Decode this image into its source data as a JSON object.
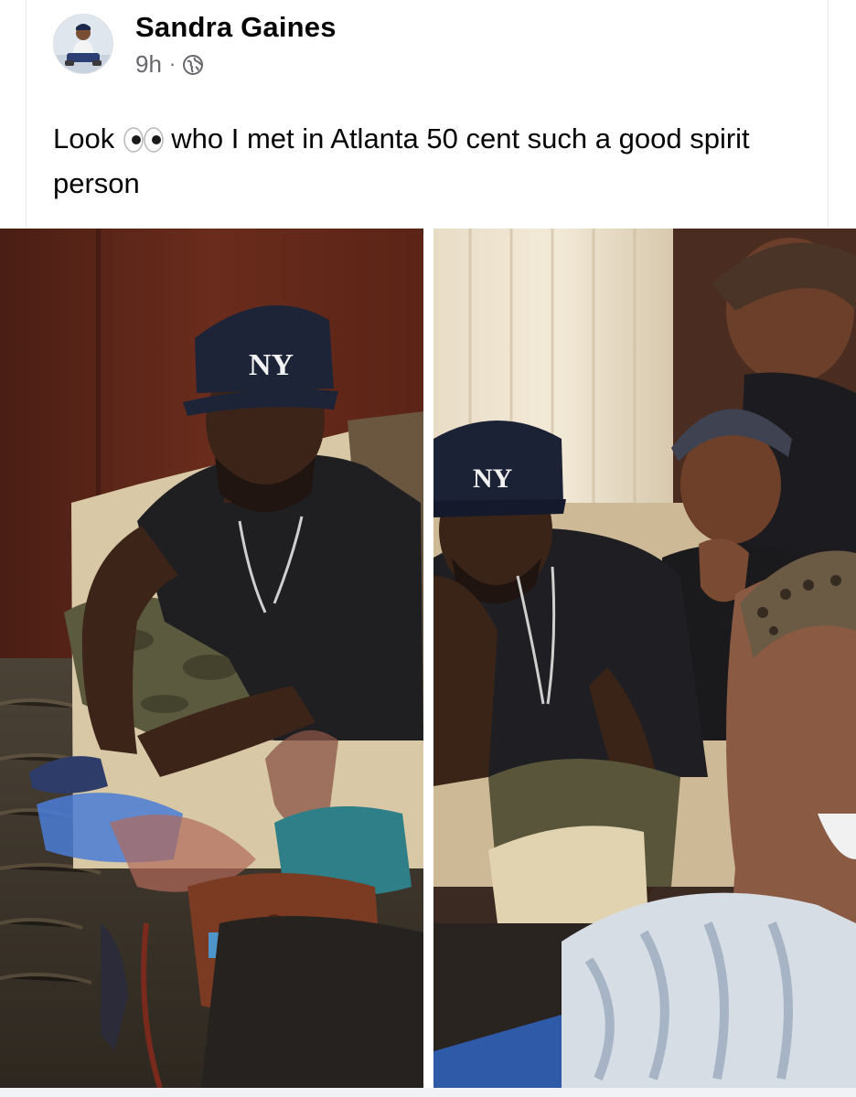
{
  "post": {
    "author": "Sandra Gaines",
    "time": "9h",
    "separator": "·",
    "privacy_icon": "globe-icon",
    "text_before_emoji": "Look",
    "emoji": "eyes-icon",
    "text_after_emoji": "who I met in Atlanta 50 cent  such a good spirit person"
  },
  "photos": [
    {
      "name": "photo-left",
      "cap_logo": "NY"
    },
    {
      "name": "photo-right",
      "cap_logo": "NY"
    }
  ],
  "colors": {
    "name_text": "#050505",
    "meta_text": "#65676b",
    "divider": "#e4e6eb"
  }
}
